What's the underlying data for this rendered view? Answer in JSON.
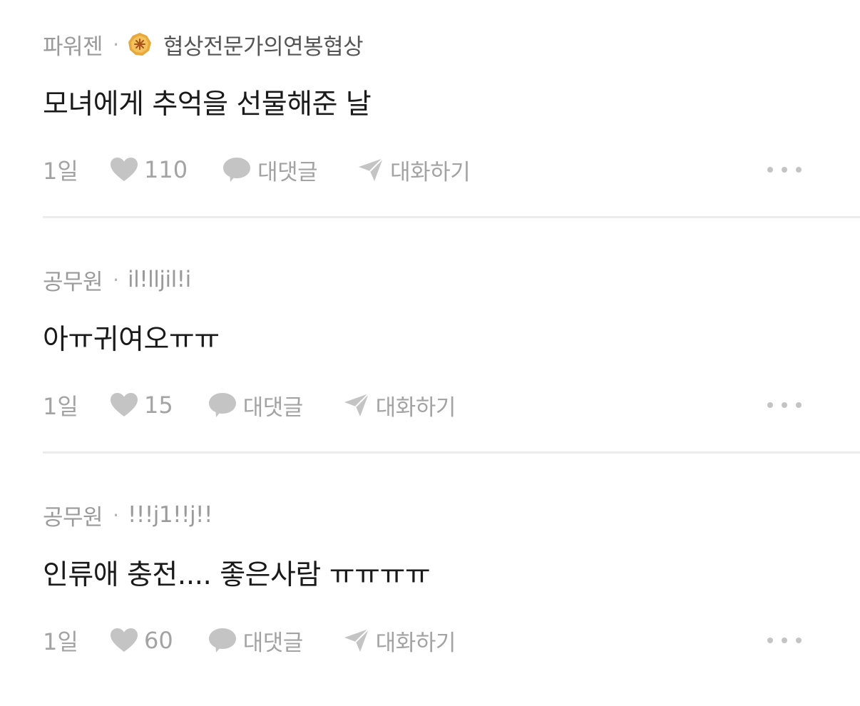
{
  "comments": [
    {
      "company": "파워젠",
      "separator": "·",
      "badge_icon": "gold-badge-icon",
      "nickname": "협상전문가의연봉협상",
      "content": "모녀에게 추억을 선물해준 날",
      "time": "1일",
      "like_icon": "heart-icon",
      "likes": "110",
      "reply_icon": "speech-bubble-icon",
      "reply_label": "대댓글",
      "chat_icon": "paper-plane-icon",
      "chat_label": "대화하기",
      "more_icon": "ellipsis-icon"
    },
    {
      "company": "공무원",
      "separator": "·",
      "nickname": "il!lljil!i",
      "content": "아ㅠ귀여오ㅠㅠ",
      "time": "1일",
      "like_icon": "heart-icon",
      "likes": "15",
      "reply_icon": "speech-bubble-icon",
      "reply_label": "대댓글",
      "chat_icon": "paper-plane-icon",
      "chat_label": "대화하기",
      "more_icon": "ellipsis-icon"
    },
    {
      "company": "공무원",
      "separator": "·",
      "nickname": "!!!j1!!j!!",
      "content": "인류애 충전.... 좋은사람 ㅠㅠㅠㅠ",
      "time": "1일",
      "like_icon": "heart-icon",
      "likes": "60",
      "reply_icon": "speech-bubble-icon",
      "reply_label": "대댓글",
      "chat_icon": "paper-plane-icon",
      "chat_label": "대화하기",
      "more_icon": "ellipsis-icon"
    }
  ],
  "colors": {
    "meta_grey": "#9a9a9a",
    "nickname_dark": "#555555",
    "content_text": "#1a1a1a",
    "action_grey": "#a3a3a3",
    "icon_grey": "#c4c4c4",
    "divider": "#ececec",
    "badge_gold": "#e8a93c"
  }
}
